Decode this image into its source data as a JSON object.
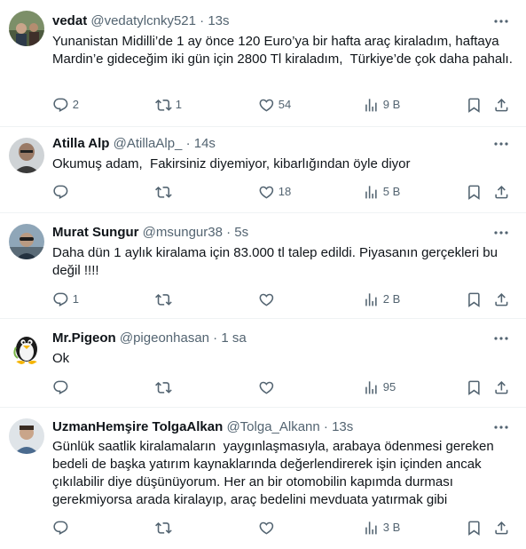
{
  "icons": {
    "more": "more-dots-icon",
    "reply": "reply-icon",
    "repost": "repost-icon",
    "like": "like-icon",
    "views": "views-icon",
    "bookmark": "bookmark-icon",
    "share": "share-icon"
  },
  "colors": {
    "text": "#0f1419",
    "secondary": "#536471",
    "divider": "#eff3f4"
  },
  "tweets": [
    {
      "name": "vedat",
      "handle": "@vedatylcnky521",
      "separator": "·",
      "time": "13s",
      "text": "Yunanistan Midilli’de 1 ay önce 120 Euro’ya bir hafta araç kiraladım, haftaya Mardin’e gideceğim iki gün için 2800 Tl kiraladım,  Türkiye’de çok daha pahalı.",
      "replies": "2",
      "reposts": "1",
      "likes": "54",
      "views": "9 B"
    },
    {
      "name": "Atilla Alp",
      "handle": "@AtillaAlp_",
      "separator": "·",
      "time": "14s",
      "text": "Okumuş adam,  Fakirsiniz diyemiyor, kibarlığından öyle diyor",
      "replies": "",
      "reposts": "",
      "likes": "18",
      "views": "5 B"
    },
    {
      "name": "Murat Sungur",
      "handle": "@msungur38",
      "separator": "·",
      "time": "5s",
      "text": "Daha dün 1 aylık kiralama için 83.000 tl talep edildi. Piyasanın gerçekleri bu değil !!!!",
      "replies": "1",
      "reposts": "",
      "likes": "",
      "views": "2 B"
    },
    {
      "name": "Mr.Pigeon",
      "handle": "@pigeonhasan",
      "separator": "·",
      "time": "1 sa",
      "text": "Ok",
      "replies": "",
      "reposts": "",
      "likes": "",
      "views": "95"
    },
    {
      "name": "UzmanHemşire TolgaAlkan",
      "handle": "@Tolga_Alkann",
      "separator": "·",
      "time": "13s",
      "text": "Günlük saatlik kiralamaların  yaygınlaşmasıyla, arabaya ödenmesi gereken bedeli de başka yatırım kaynaklarında değerlendirerek işin içinden ancak çıkılabilir diye düşünüyorum. Her an bir otomobilin kapımda durması gerekmiyorsa arada kiralayıp, araç bedelini mevduata yatırmak gibi",
      "replies": "",
      "reposts": "",
      "likes": "",
      "views": "3 B"
    }
  ]
}
